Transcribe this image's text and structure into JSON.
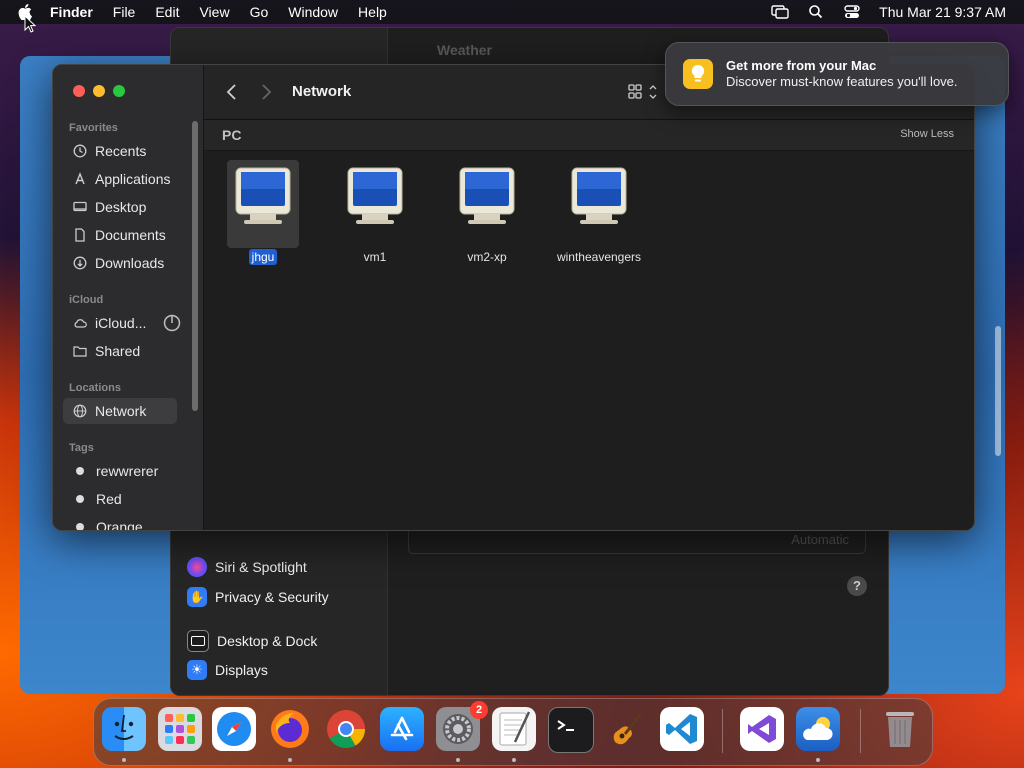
{
  "menubar": {
    "app": "Finder",
    "items": [
      "File",
      "Edit",
      "View",
      "Go",
      "Window",
      "Help"
    ],
    "clock": "Thu Mar 21  9:37 AM"
  },
  "settings_bg": {
    "title_hint": "Weather",
    "items": [
      "Siri & Spotlight",
      "Privacy & Security",
      "Desktop & Dock",
      "Displays"
    ],
    "popup_value": "Automatic",
    "help": "?"
  },
  "finder": {
    "title": "Network",
    "sidebar": {
      "favorites_label": "Favorites",
      "favorites": [
        "Recents",
        "Applications",
        "Desktop",
        "Documents",
        "Downloads"
      ],
      "icloud_label": "iCloud",
      "icloud": [
        "iCloud...",
        "Shared"
      ],
      "locations_label": "Locations",
      "locations": [
        "Network"
      ],
      "tags_label": "Tags",
      "tags": [
        "rewwrerer",
        "Red",
        "Orange"
      ]
    },
    "group": {
      "name": "PC",
      "toggle": "Show Less"
    },
    "hosts": [
      "jhgu",
      "vm1",
      "vm2-xp",
      "wintheavengers"
    ],
    "selected_host": "jhgu"
  },
  "notification": {
    "title": "Get more from your Mac",
    "body": "Discover must-know features you'll love."
  },
  "dock": {
    "apps": [
      "Finder",
      "Launchpad",
      "Safari",
      "Firefox",
      "Chrome",
      "App Store",
      "System Settings",
      "TextEdit",
      "Terminal",
      "GarageBand",
      "Visual Studio Code",
      "Visual Studio",
      "Weather",
      "Trash"
    ],
    "settings_badge": "2"
  },
  "colors": {
    "accent": "#1f5fd0",
    "close": "#ff5f57",
    "minimize": "#febc2e",
    "zoom": "#28c840",
    "tag_red": "#ff453a",
    "tag_orange": "#ff9f0a"
  }
}
